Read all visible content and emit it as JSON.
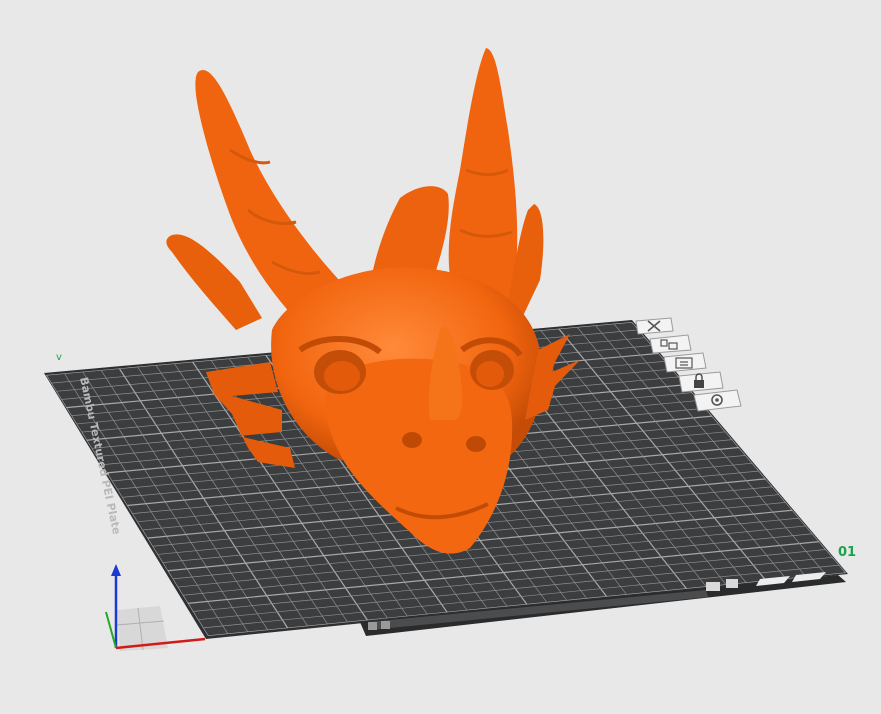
{
  "viewport": {
    "plate_label": "Bambu Textured PEI Plate",
    "plate_number": "01",
    "corner_marker": "v",
    "colors": {
      "background": "#e8e8e8",
      "plate": "#3b3d3f",
      "grid": "#8c8e90",
      "model": "#f2650f",
      "plate_number": "#1aa34a",
      "axis_x": "#d11a1a",
      "axis_y": "#22aa22",
      "axis_z": "#1a3ad1"
    }
  },
  "plate_toolbar": [
    {
      "name": "delete-plate",
      "icon": "close-icon"
    },
    {
      "name": "arrange-plate",
      "icon": "arrange-icon"
    },
    {
      "name": "orient-plate",
      "icon": "orient-icon"
    },
    {
      "name": "lock-plate",
      "icon": "lock-icon"
    },
    {
      "name": "plate-settings",
      "icon": "gear-icon"
    }
  ],
  "model": {
    "name": "dragon-head",
    "icon": "dragon-head-model"
  }
}
